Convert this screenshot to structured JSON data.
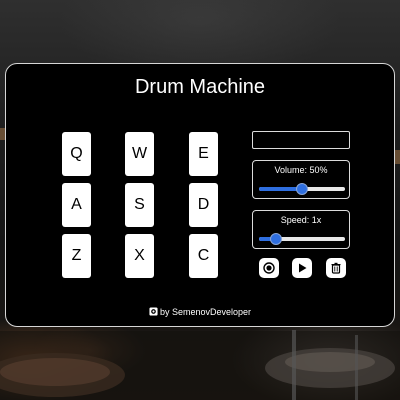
{
  "app": {
    "title": "Drum Machine"
  },
  "pads": [
    {
      "key": "Q"
    },
    {
      "key": "W"
    },
    {
      "key": "E"
    },
    {
      "key": "A"
    },
    {
      "key": "S"
    },
    {
      "key": "D"
    },
    {
      "key": "Z"
    },
    {
      "key": "X"
    },
    {
      "key": "C"
    }
  ],
  "display": {
    "text": ""
  },
  "volume": {
    "label": "Volume: 50%",
    "value": 0.5
  },
  "speed": {
    "label": "Speed: 1x",
    "value": 0.2
  },
  "controls": [
    {
      "icon": "record-icon"
    },
    {
      "icon": "play-icon"
    },
    {
      "icon": "trash-icon"
    }
  ],
  "footer": {
    "credit": "by SemenovDeveloper",
    "icon": "github-icon"
  },
  "colors": {
    "accent": "#2f6fe0",
    "panel": "#000000",
    "pad": "#ffffff"
  }
}
